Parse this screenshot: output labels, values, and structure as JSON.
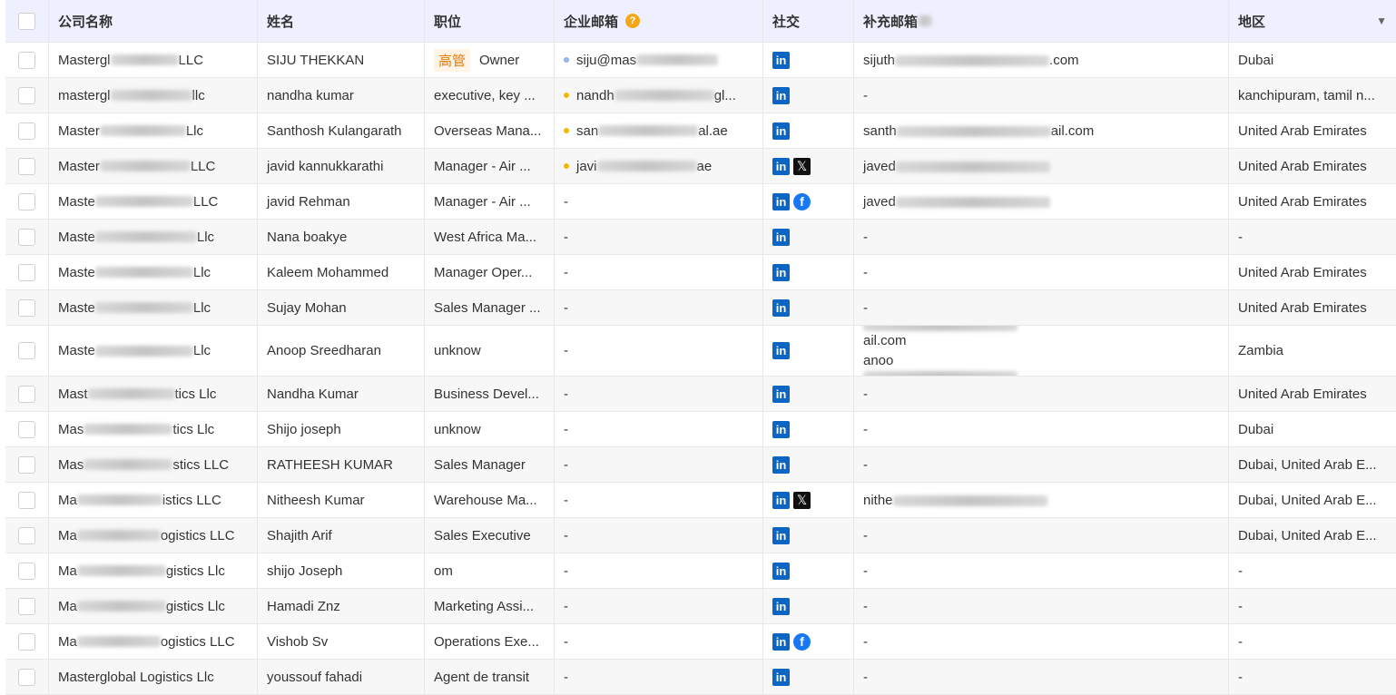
{
  "headers": {
    "company": "公司名称",
    "name": "姓名",
    "position": "职位",
    "work_email": "企业邮箱",
    "work_email_help": "?",
    "social": "社交",
    "extra_email": "补充邮箱",
    "region": "地区"
  },
  "icons": {
    "linkedin": "in",
    "x": "𝕏",
    "facebook": "f",
    "help": "help-icon",
    "filter": "filter-icon"
  },
  "colors": {
    "header_bg": "#eef0ff",
    "tag_bg": "#fff4e6",
    "tag_text": "#e07b0a",
    "linkedin": "#0a66c2",
    "dot_blue": "#8fb4f0",
    "dot_yellow": "#f5b800"
  },
  "rows": [
    {
      "company_a": "Mastergl",
      "company_b": "LLC",
      "name": "SIJU THEKKAN",
      "tag": "高管",
      "position": "Owner",
      "email_a": "siju@mas",
      "email_b": "",
      "dot": "blue",
      "social": [
        "li"
      ],
      "extra": [
        "sijuth|.com"
      ],
      "region": "Dubai"
    },
    {
      "company_a": "mastergl",
      "company_b": "llc",
      "name": "nandha kumar",
      "position": "executive, key ...",
      "email_a": "nandh",
      "email_b": "gl...",
      "dot": "yellow",
      "social": [
        "li"
      ],
      "extra": [
        "-"
      ],
      "region": "kanchipuram, tamil n..."
    },
    {
      "company_a": "Master",
      "company_b": "Llc",
      "name": "Santhosh Kulangarath",
      "position": "Overseas Mana...",
      "email_a": "san",
      "email_b": "al.ae",
      "dot": "yellow",
      "social": [
        "li"
      ],
      "extra": [
        "santh|ail.com"
      ],
      "region": "United Arab Emirates"
    },
    {
      "company_a": "Master",
      "company_b": "LLC",
      "name": "javid kannukkarathi",
      "position": "Manager - Air ...",
      "email_a": "javi",
      "email_b": "ae",
      "dot": "yellow",
      "social": [
        "li",
        "x"
      ],
      "extra": [
        "javed|"
      ],
      "region": "United Arab Emirates"
    },
    {
      "company_a": "Maste",
      "company_b": "LLC",
      "name": "javid Rehman",
      "position": "Manager - Air ...",
      "email_a": "-",
      "social": [
        "li",
        "fb"
      ],
      "extra": [
        "javed|"
      ],
      "region": "United Arab Emirates"
    },
    {
      "company_a": "Maste",
      "company_b": "Llc",
      "name": "Nana boakye",
      "position": "West Africa Ma...",
      "email_a": "-",
      "social": [
        "li"
      ],
      "extra": [
        "-"
      ],
      "region": "-"
    },
    {
      "company_a": "Maste",
      "company_b": "Llc",
      "name": "Kaleem Mohammed",
      "position": "Manager Oper...",
      "email_a": "-",
      "social": [
        "li"
      ],
      "extra": [
        "-"
      ],
      "region": "United Arab Emirates"
    },
    {
      "company_a": "Maste",
      "company_b": "Llc",
      "name": "Sujay Mohan",
      "position": "Sales Manager ...",
      "email_a": "-",
      "social": [
        "li"
      ],
      "extra": [
        "-"
      ],
      "region": "United Arab Emirates"
    },
    {
      "company_a": "Maste",
      "company_b": "Llc",
      "name": "Anoop Sreedharan",
      "position": "unknow",
      "email_a": "-",
      "social": [
        "li"
      ],
      "extra": [
        "anoo|ail.com",
        "anoo|ail.com"
      ],
      "region": "Zambia",
      "tall": true
    },
    {
      "company_a": "Mast",
      "company_b": "tics Llc",
      "name": "Nandha Kumar",
      "position": "Business Devel...",
      "email_a": "-",
      "social": [
        "li"
      ],
      "extra": [
        "-"
      ],
      "region": "United Arab Emirates"
    },
    {
      "company_a": "Mas",
      "company_b": "tics Llc",
      "name": "Shijo joseph",
      "position": "unknow",
      "email_a": "-",
      "social": [
        "li"
      ],
      "extra": [
        "-"
      ],
      "region": "Dubai"
    },
    {
      "company_a": "Mas",
      "company_b": "stics LLC",
      "name": "RATHEESH KUMAR",
      "position": "Sales Manager",
      "email_a": "-",
      "social": [
        "li"
      ],
      "extra": [
        "-"
      ],
      "region": "Dubai, United Arab E..."
    },
    {
      "company_a": "Ma",
      "company_b": "istics LLC",
      "name": "Nitheesh Kumar",
      "position": "Warehouse Ma...",
      "email_a": "-",
      "social": [
        "li",
        "x"
      ],
      "extra": [
        "nithe|"
      ],
      "region": "Dubai, United Arab E..."
    },
    {
      "company_a": "Ma",
      "company_b": "ogistics LLC",
      "name": "Shajith Arif",
      "position": "Sales Executive",
      "email_a": "-",
      "social": [
        "li"
      ],
      "extra": [
        "-"
      ],
      "region": "Dubai, United Arab E..."
    },
    {
      "company_a": "Ma",
      "company_b": "gistics Llc",
      "name": "shijo Joseph",
      "position": "om",
      "email_a": "-",
      "social": [
        "li"
      ],
      "extra": [
        "-"
      ],
      "region": "-"
    },
    {
      "company_a": "Ma",
      "company_b": "gistics Llc",
      "name": "Hamadi Znz",
      "position": "Marketing Assi...",
      "email_a": "-",
      "social": [
        "li"
      ],
      "extra": [
        "-"
      ],
      "region": "-"
    },
    {
      "company_a": "Ma",
      "company_b": "ogistics LLC",
      "name": "Vishob Sv",
      "position": "Operations Exe...",
      "email_a": "-",
      "social": [
        "li",
        "fb"
      ],
      "extra": [
        "-"
      ],
      "region": "-"
    },
    {
      "company_a": "Masterglobal Logistics Llc",
      "company_b": "",
      "name": "youssouf fahadi",
      "position": "Agent de transit",
      "email_a": "-",
      "social": [
        "li"
      ],
      "extra": [
        "-"
      ],
      "region": "-"
    }
  ]
}
